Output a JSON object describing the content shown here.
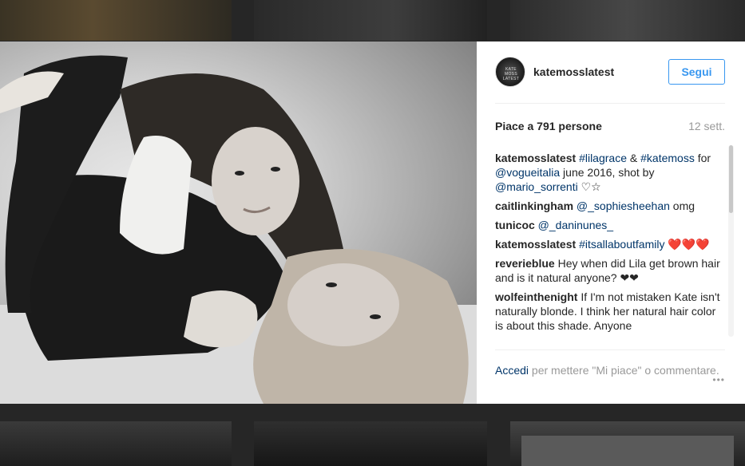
{
  "post": {
    "username": "katemosslatest",
    "avatar_text": "KATE MOSS LATEST",
    "follow_label": "Segui",
    "likes": "Piace a 791 persone",
    "time_ago": "12 sett.",
    "comments": [
      {
        "user": "katemosslatest",
        "parts": [
          {
            "t": "tag",
            "v": "#lilagrace"
          },
          {
            "t": "text",
            "v": " & "
          },
          {
            "t": "tag",
            "v": "#katemoss"
          },
          {
            "t": "text",
            "v": " for "
          },
          {
            "t": "tag",
            "v": "@vogueitalia"
          },
          {
            "t": "text",
            "v": " june 2016, shot by "
          },
          {
            "t": "tag",
            "v": "@mario_sorrenti"
          },
          {
            "t": "text",
            "v": " ♡☆"
          }
        ]
      },
      {
        "user": "caitlinkingham",
        "parts": [
          {
            "t": "tag",
            "v": "@_sophiesheehan"
          },
          {
            "t": "text",
            "v": " omg"
          }
        ]
      },
      {
        "user": "tunicoc",
        "parts": [
          {
            "t": "tag",
            "v": "@_daninunes_"
          }
        ]
      },
      {
        "user": "katemosslatest",
        "parts": [
          {
            "t": "tag",
            "v": "#itsallaboutfamily"
          },
          {
            "t": "text",
            "v": " ❤️❤️❤️"
          }
        ]
      },
      {
        "user": "reverieblue",
        "parts": [
          {
            "t": "text",
            "v": "Hey when did Lila get brown hair and is it natural anyone? ❤❤"
          }
        ]
      },
      {
        "user": "wolfeinthenight",
        "parts": [
          {
            "t": "text",
            "v": "If I'm not mistaken Kate isn't naturally blonde. I think her natural hair color is about this shade. Anyone"
          }
        ]
      }
    ],
    "footer": {
      "login_label": "Accedi",
      "rest_text": "per mettere \"Mi piace\" o commentare.",
      "more_icon": "•••"
    }
  },
  "icons": {
    "more": "more-options-icon"
  }
}
